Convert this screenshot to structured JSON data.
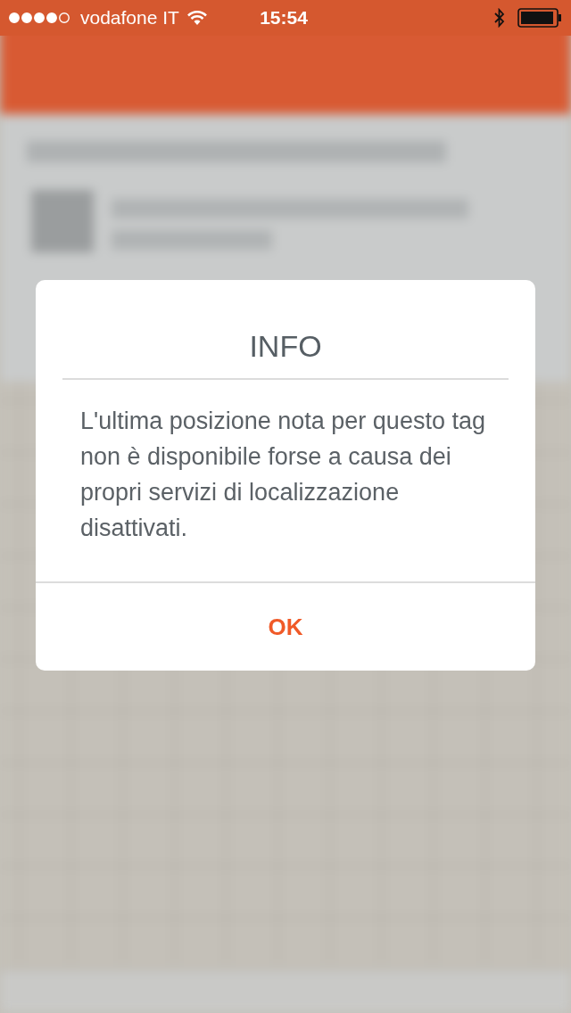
{
  "status_bar": {
    "carrier": "vodafone IT",
    "time": "15:54"
  },
  "dialog": {
    "title": "INFO",
    "message": "L'ultima posizione nota per questo tag non è disponibile forse a causa dei  propri servizi di localizzazione disattivati.",
    "buttons": [
      "OK"
    ]
  }
}
